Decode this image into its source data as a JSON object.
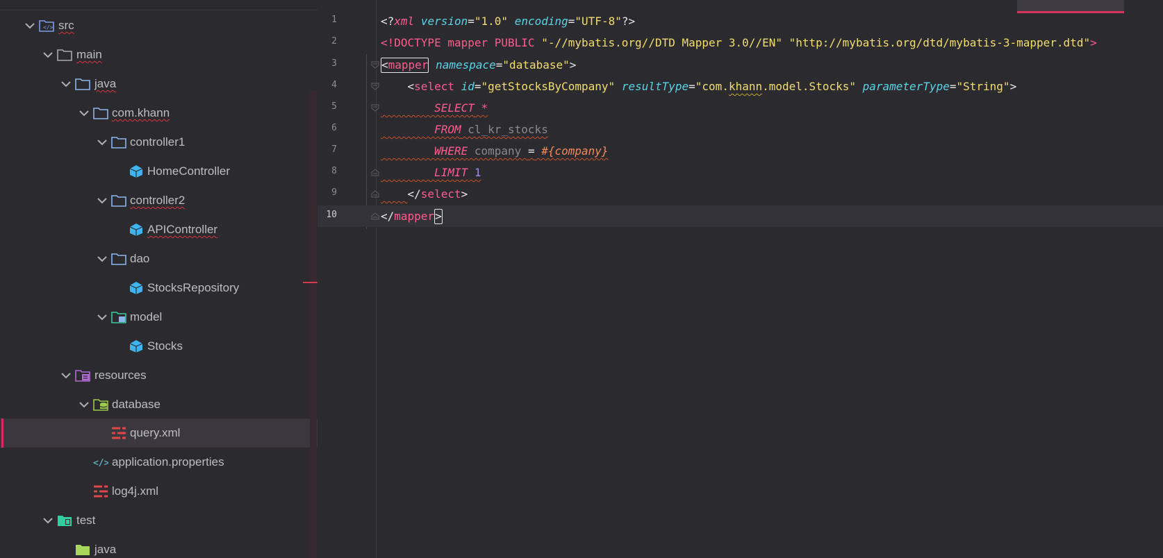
{
  "sidebar": {
    "tree": [
      {
        "label": "src",
        "icon": "source-folder-icon",
        "expanded": true
      },
      {
        "label": "main",
        "icon": "folder-icon",
        "expanded": true
      },
      {
        "label": "java",
        "icon": "folder-icon",
        "expanded": true
      },
      {
        "label": "com.khann",
        "icon": "folder-icon",
        "expanded": true
      },
      {
        "label": "controller1",
        "icon": "folder-icon",
        "expanded": true
      },
      {
        "label": "HomeController",
        "icon": "java-class-icon"
      },
      {
        "label": "controller2",
        "icon": "folder-icon",
        "expanded": true
      },
      {
        "label": "APIController",
        "icon": "java-class-icon"
      },
      {
        "label": "dao",
        "icon": "folder-icon",
        "expanded": true
      },
      {
        "label": "StocksRepository",
        "icon": "java-class-icon"
      },
      {
        "label": "model",
        "icon": "model-folder-icon",
        "expanded": true
      },
      {
        "label": "Stocks",
        "icon": "java-class-icon"
      },
      {
        "label": "resources",
        "icon": "resources-folder-icon",
        "expanded": true
      },
      {
        "label": "database",
        "icon": "database-folder-icon",
        "expanded": true
      },
      {
        "label": "query.xml",
        "icon": "xml-file-icon",
        "selected": true
      },
      {
        "label": "application.properties",
        "icon": "properties-file-icon"
      },
      {
        "label": "log4j.xml",
        "icon": "xml-file-icon"
      },
      {
        "label": "test",
        "icon": "test-folder-icon",
        "expanded": true
      },
      {
        "label": "java",
        "icon": "folder-icon"
      }
    ]
  },
  "editor": {
    "line_numbers": [
      "1",
      "2",
      "3",
      "4",
      "5",
      "6",
      "7",
      "8",
      "9",
      "10"
    ],
    "current_line": "10",
    "tokens": {
      "l1": {
        "open": "<?",
        "name": "xml",
        "a1": "version",
        "eq": "=",
        "v1": "\"1.0\"",
        "a2": "encoding",
        "v2": "\"UTF-8\"",
        "close": "?>"
      },
      "l2": {
        "text1": "<!DOCTYPE ",
        "name": "mapper PUBLIC ",
        "s1": "\"-//mybatis.org//DTD Mapper 3.0//EN\"",
        "s2": "\"http://mybatis.org/dtd/mybatis-3-mapper.dtd\"",
        "close": ">"
      },
      "l3": {
        "lt": "<",
        "tag": "mapper",
        "attr": "namespace",
        "eq": "=",
        "val": "\"database\"",
        "gt": ">"
      },
      "l4": {
        "lt": "<",
        "tag": "select",
        "a1": "id",
        "v1": "\"getStocksByCompany\"",
        "a2": "resultType",
        "v2a": "\"com.",
        "v2b": "khann",
        "v2c": ".model.Stocks\"",
        "a3": "parameterType",
        "v3": "\"String\"",
        "eq": "=",
        "gt": ">"
      },
      "l5": {
        "kw": "SELECT",
        "rest": " *"
      },
      "l6": {
        "kw": "FROM",
        "rest": " cl_kr_stocks"
      },
      "l7": {
        "kw": "WHERE",
        "col": " company ",
        "op": "=",
        "param": " #{company}"
      },
      "l8": {
        "kw": "LIMIT",
        "num": " 1"
      },
      "l9": {
        "lt": "</",
        "tag": "select",
        "gt": ">"
      },
      "l10": {
        "lt": "</",
        "tag": "mapper",
        "gt": ">"
      }
    }
  },
  "colors": {
    "background": "#2b2a2f",
    "tag": "#ff5c8d",
    "attribute": "#5ad4e6",
    "string": "#f3dd6f",
    "selection_accent": "#e02a5a"
  }
}
